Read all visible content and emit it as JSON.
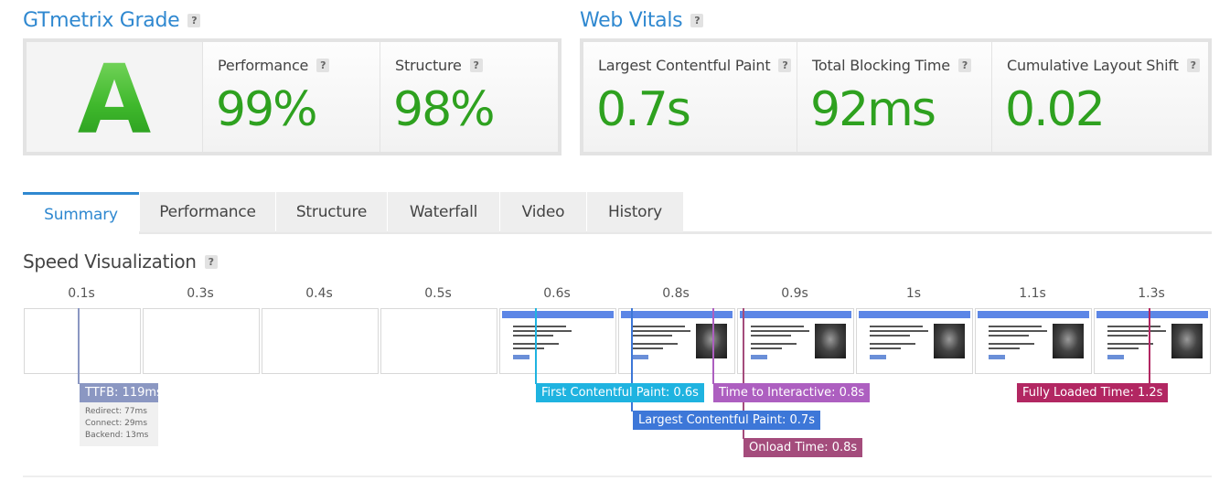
{
  "grade_section": {
    "title": "GTmetrix Grade",
    "help": "?",
    "grade": "A",
    "performance": {
      "label": "Performance",
      "value": "99%"
    },
    "structure": {
      "label": "Structure",
      "value": "98%"
    }
  },
  "vitals_section": {
    "title": "Web Vitals",
    "help": "?",
    "lcp": {
      "label": "Largest Contentful Paint",
      "value": "0.7s"
    },
    "tbt": {
      "label": "Total Blocking Time",
      "value": "92ms"
    },
    "cls": {
      "label": "Cumulative Layout Shift",
      "value": "0.02"
    }
  },
  "tabs": [
    {
      "label": "Summary",
      "active": true
    },
    {
      "label": "Performance"
    },
    {
      "label": "Structure"
    },
    {
      "label": "Waterfall"
    },
    {
      "label": "Video"
    },
    {
      "label": "History"
    }
  ],
  "speed_viz": {
    "title": "Speed Visualization",
    "help": "?",
    "ticks": [
      "0.1s",
      "0.3s",
      "0.4s",
      "0.5s",
      "0.6s",
      "0.8s",
      "0.9s",
      "1s",
      "1.1s",
      "1.3s"
    ],
    "frames": [
      "blank",
      "blank",
      "blank",
      "blank",
      "text",
      "photo",
      "photo",
      "photo",
      "photo",
      "photo"
    ],
    "markers": {
      "ttfb": {
        "label": "TTFB: 119ms",
        "color": "#8b97c2"
      },
      "fcp": {
        "label": "First Contentful Paint: 0.6s",
        "color": "#1fb3e0"
      },
      "tti": {
        "label": "Time to Interactive: 0.8s",
        "color": "#ad5fc0"
      },
      "lcp": {
        "label": "Largest Contentful Paint: 0.7s",
        "color": "#3d77d8"
      },
      "onload": {
        "label": "Onload Time: 0.8s",
        "color": "#a44c7c"
      },
      "fully_loaded": {
        "label": "Fully Loaded Time: 1.2s",
        "color": "#b22762"
      }
    },
    "ttfb_breakdown": {
      "redirect": "Redirect: 77ms",
      "connect": "Connect: 29ms",
      "backend": "Backend: 13ms"
    }
  },
  "colors": {
    "accent": "#2f88d0",
    "score_green": "#2ea11f"
  }
}
